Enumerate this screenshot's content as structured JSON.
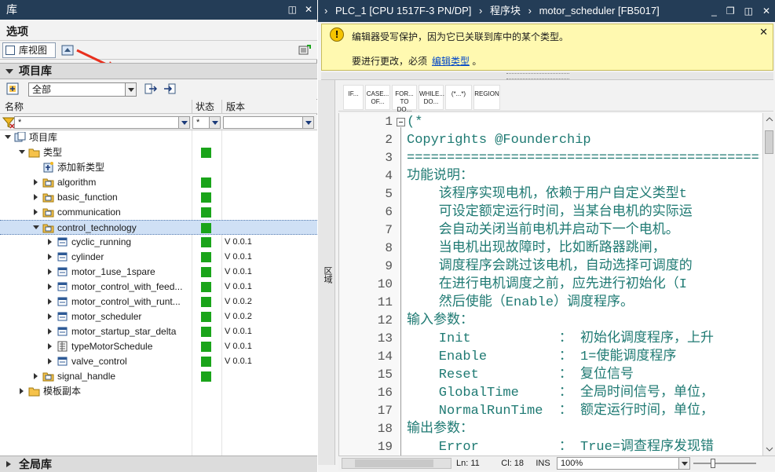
{
  "library": {
    "title": "库",
    "options_title": "选项",
    "library_view_button": "库视图",
    "project_library_header": "项目库",
    "filter_select": "全部",
    "columns": {
      "name": "名称",
      "status": "状态",
      "version": "版本"
    },
    "filter_name": "*",
    "filter_status": "*",
    "tree": [
      {
        "label": "项目库",
        "level": 0,
        "toggle": "expanded",
        "icon": "library-icon",
        "status": false,
        "version": ""
      },
      {
        "label": "类型",
        "level": 1,
        "toggle": "expanded",
        "icon": "folder-icon",
        "status": true,
        "version": ""
      },
      {
        "label": "添加新类型",
        "level": 2,
        "toggle": "none",
        "icon": "add-type-icon",
        "status": false,
        "version": ""
      },
      {
        "label": "algorithm",
        "level": 2,
        "toggle": "collapsed",
        "icon": "type-folder-icon",
        "status": true,
        "version": ""
      },
      {
        "label": "basic_function",
        "level": 2,
        "toggle": "collapsed",
        "icon": "type-folder-icon",
        "status": true,
        "version": ""
      },
      {
        "label": "communication",
        "level": 2,
        "toggle": "collapsed",
        "icon": "type-folder-icon",
        "status": true,
        "version": ""
      },
      {
        "label": "control_technology",
        "level": 2,
        "toggle": "expanded",
        "icon": "type-folder-icon",
        "status": true,
        "version": "",
        "selected": true
      },
      {
        "label": "cyclic_running",
        "level": 3,
        "toggle": "collapsed",
        "icon": "function-block-icon",
        "status": true,
        "version": "V 0.0.1"
      },
      {
        "label": "cylinder",
        "level": 3,
        "toggle": "collapsed",
        "icon": "function-block-icon",
        "status": true,
        "version": "V 0.0.1"
      },
      {
        "label": "motor_1use_1spare",
        "level": 3,
        "toggle": "collapsed",
        "icon": "function-block-icon",
        "status": true,
        "version": "V 0.0.1"
      },
      {
        "label": "motor_control_with_feed...",
        "level": 3,
        "toggle": "collapsed",
        "icon": "function-block-icon",
        "status": true,
        "version": "V 0.0.1"
      },
      {
        "label": "motor_control_with_runt...",
        "level": 3,
        "toggle": "collapsed",
        "icon": "function-block-icon",
        "status": true,
        "version": "V 0.0.2"
      },
      {
        "label": "motor_scheduler",
        "level": 3,
        "toggle": "collapsed",
        "icon": "function-block-icon",
        "status": true,
        "version": "V 0.0.2"
      },
      {
        "label": "motor_startup_star_delta",
        "level": 3,
        "toggle": "collapsed",
        "icon": "function-block-icon",
        "status": true,
        "version": "V 0.0.1"
      },
      {
        "label": "typeMotorSchedule",
        "level": 3,
        "toggle": "collapsed",
        "icon": "datatype-icon",
        "status": true,
        "version": "V 0.0.1"
      },
      {
        "label": "valve_control",
        "level": 3,
        "toggle": "collapsed",
        "icon": "function-block-icon",
        "status": true,
        "version": "V 0.0.1"
      },
      {
        "label": "signal_handle",
        "level": 2,
        "toggle": "collapsed",
        "icon": "type-folder-icon",
        "status": true,
        "version": ""
      },
      {
        "label": "模板副本",
        "level": 1,
        "toggle": "collapsed",
        "icon": "folder-icon",
        "status": false,
        "version": ""
      }
    ],
    "global_library_header": "全局库",
    "status_color": "#1aa41a"
  },
  "editor": {
    "breadcrumb": [
      "PLC_1 [CPU 1517F-3 PN/DP]",
      "程序块",
      "motor_scheduler [FB5017]"
    ],
    "warning": {
      "line1": "编辑器受写保护，因为它已关联到库中的某个类型。",
      "line2": "要进行更改，必须",
      "link": "编辑类型",
      "line2_end": "。"
    },
    "side_label": "区域",
    "toolbar": [
      {
        "label": "IF...",
        "icon": ""
      },
      {
        "label": "CASE... OF...",
        "icon": ""
      },
      {
        "label": "FOR... TO DO...",
        "icon": ""
      },
      {
        "label": "WHILE... DO...",
        "icon": ""
      },
      {
        "label": "(*...*)",
        "icon": ""
      },
      {
        "label": "REGION",
        "icon": ""
      }
    ],
    "code_lines": [
      {
        "n": "1",
        "text": "(*"
      },
      {
        "n": "2",
        "text": "Copyrights @Founderchip"
      },
      {
        "n": "3",
        "text": "=================================================="
      },
      {
        "n": "4",
        "text": "功能说明："
      },
      {
        "n": "5",
        "text": "    该程序实现电机，依赖于用户自定义类型t"
      },
      {
        "n": "6",
        "text": "    可设定额定运行时间，当某台电机的实际运"
      },
      {
        "n": "7",
        "text": "    会自动关闭当前电机并启动下一个电机。"
      },
      {
        "n": "8",
        "text": "    当电机出现故障时，比如断路器跳闸，"
      },
      {
        "n": "9",
        "text": "    调度程序会跳过该电机，自动选择可调度的"
      },
      {
        "n": "10",
        "text": "    在进行电机调度之前，应先进行初始化（I"
      },
      {
        "n": "11",
        "text": "    然后使能（Enable）调度程序。"
      },
      {
        "n": "12",
        "text": "输入参数："
      },
      {
        "n": "13",
        "text": "    Init           ： 初始化调度程序，上升"
      },
      {
        "n": "14",
        "text": "    Enable         ： 1=使能调度程序"
      },
      {
        "n": "15",
        "text": "    Reset          ： 复位信号"
      },
      {
        "n": "16",
        "text": "    GlobalTime     ： 全局时间信号，单位，"
      },
      {
        "n": "17",
        "text": "    NormalRunTime  ： 额定运行时间，单位，"
      },
      {
        "n": "18",
        "text": "输出参数："
      },
      {
        "n": "19",
        "text": "    Error          ： True=调查程序发现错"
      }
    ],
    "status": {
      "line": "Ln: 11",
      "col": "Cl: 18",
      "mode": "INS",
      "zoom": "100%"
    },
    "code_color": "#1f7a73"
  }
}
